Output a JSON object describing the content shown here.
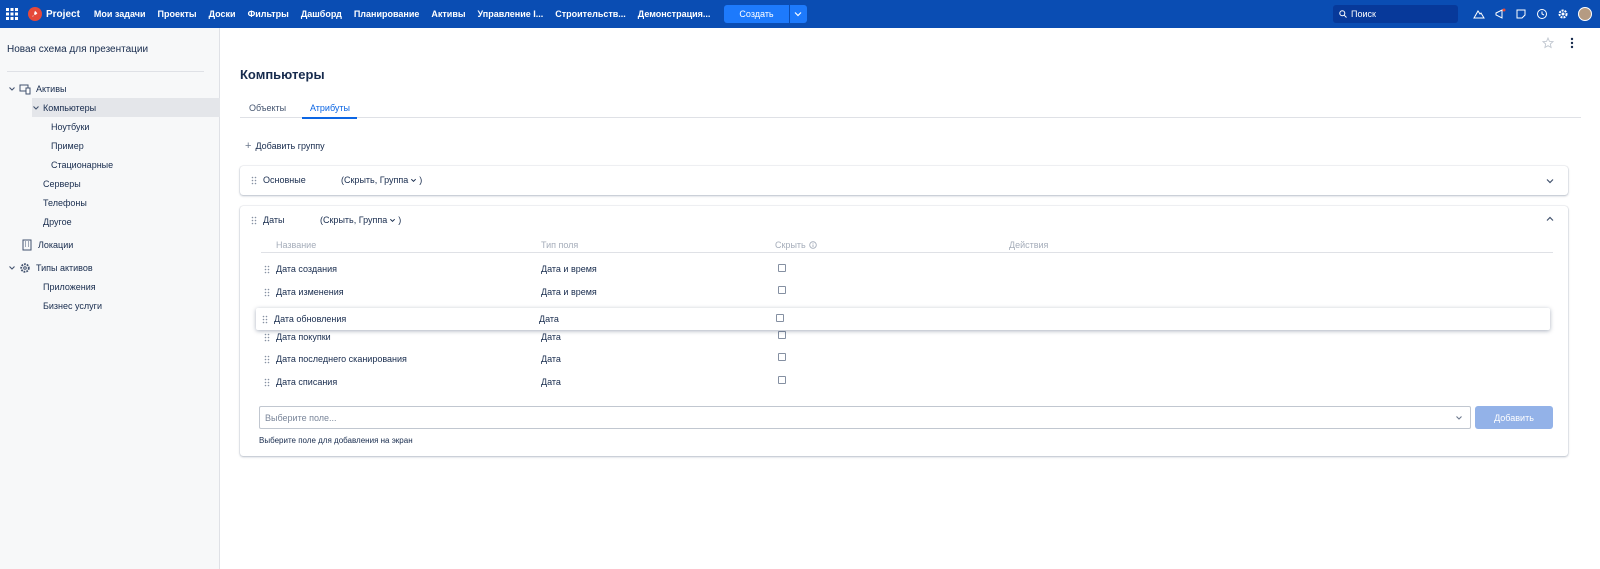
{
  "topbar": {
    "brand": "Project",
    "nav": [
      "Мои задачи",
      "Проекты",
      "Доски",
      "Фильтры",
      "Дашборд",
      "Планирование",
      "Активы",
      "Управление I...",
      "Строительств...",
      "Демонстрация..."
    ],
    "create_label": "Создать",
    "search_placeholder": "Поиск",
    "accent": "#0a4db3"
  },
  "sidebar": {
    "title": "Новая схема для презентации",
    "items": [
      {
        "label": "Активы",
        "icon": "assets-icon"
      },
      {
        "label": "Компьютеры",
        "selected": true
      },
      {
        "label": "Ноутбуки"
      },
      {
        "label": "Пример"
      },
      {
        "label": "Стационарные"
      },
      {
        "label": "Серверы"
      },
      {
        "label": "Телефоны"
      },
      {
        "label": "Другое"
      },
      {
        "label": "Локации",
        "icon": "building-icon"
      },
      {
        "label": "Типы активов",
        "icon": "gear-icon"
      },
      {
        "label": "Приложения"
      },
      {
        "label": "Бизнес услуги"
      }
    ]
  },
  "main": {
    "title": "Компьютеры",
    "tabs": [
      {
        "label": "Объекты",
        "active": false
      },
      {
        "label": "Атрибуты",
        "active": true
      }
    ],
    "add_group_label": "Добавить группу",
    "groups": [
      {
        "name": "Основные",
        "meta": "(Скрыть, Группа",
        "meta_close": ")",
        "expanded": false
      },
      {
        "name": "Даты",
        "meta": "(Скрыть, Группа",
        "meta_close": ")",
        "expanded": true
      }
    ],
    "columns": {
      "name": "Название",
      "type": "Тип поля",
      "hide": "Скрыть",
      "actions": "Действия"
    },
    "rows": [
      {
        "name": "Дата создания",
        "type": "Дата и время"
      },
      {
        "name": "Дата изменения",
        "type": "Дата и время"
      },
      {
        "name": "Дата обновления",
        "type": "Дата",
        "dragging": true
      },
      {
        "name": "Дата покупки",
        "type": "Дата"
      },
      {
        "name": "Дата последнего сканирования",
        "type": "Дата"
      },
      {
        "name": "Дата списания",
        "type": "Дата"
      }
    ],
    "select_placeholder": "Выберите поле...",
    "add_button": "Добавить",
    "helper": "Выберите поле для добавления на экран"
  }
}
